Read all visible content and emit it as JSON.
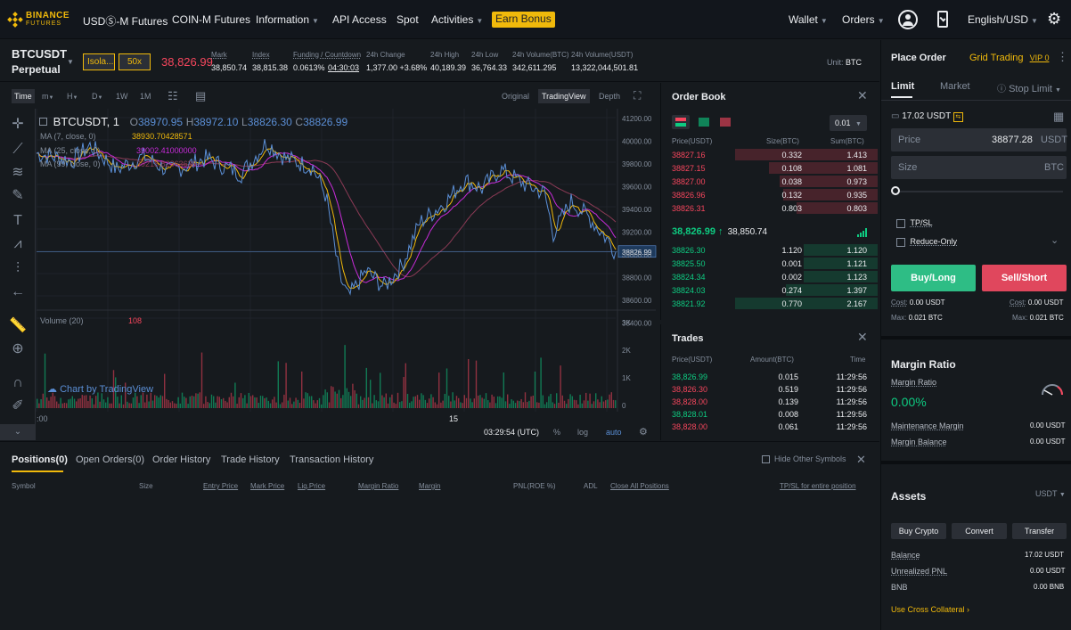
{
  "brand": {
    "line1": "BINANCE",
    "line2": "FUTURES"
  },
  "nav": {
    "usdm": "USDⓈ-M Futures",
    "coinm": "COIN-M Futures",
    "information": "Information",
    "api": "API Access",
    "spot": "Spot",
    "activities": "Activities",
    "earn": "Earn Bonus",
    "wallet": "Wallet",
    "orders": "Orders",
    "lang": "English/USD"
  },
  "ticker": {
    "symbol": "BTCUSDT",
    "type": "Perpetual",
    "margin_mode": "Isola...",
    "leverage": "50x",
    "last_price": "38,826.99",
    "mark_label": "Mark",
    "mark": "38,850.74",
    "index_label": "Index",
    "index": "38,815.38",
    "funding_label": "Funding / Countdown",
    "funding": "0.0613%",
    "countdown": "04:30:03",
    "change_label": "24h Change",
    "change": "1,377.00 +3.68%",
    "high_label": "24h High",
    "high": "40,189.39",
    "low_label": "24h Low",
    "low": "36,764.33",
    "volbtc_label": "24h Volume(BTC)",
    "volbtc": "342,611.295",
    "volusdt_label": "24h Volume(USDT)",
    "volusdt": "13,322,044,501.81",
    "unit_label": "Unit:",
    "unit": "BTC"
  },
  "chart_toolbar": {
    "time": "Time",
    "m": "m",
    "h": "H",
    "d": "D",
    "w": "1W",
    "mo": "1M",
    "original": "Original",
    "tradingview": "TradingView",
    "depth": "Depth"
  },
  "chart": {
    "title": "BTCUSDT, 1",
    "o": "38970.95",
    "h": "38972.10",
    "l": "38826.30",
    "c": "38826.99",
    "ma7_label": "MA (7, close, 0)",
    "ma7": "38930.70428571",
    "ma25_label": "MA (25, close, 0)",
    "ma25": "39002.41000000",
    "ma99_label": "MA (99, close, 0)",
    "ma99": "39218.82363636",
    "volume_label": "Volume (20)",
    "volume": "108",
    "watermark": "Chart by TradingView",
    "current_price_tag": "38826.99",
    "time_display": "03:29:54 (UTC)",
    "pct": "%",
    "log": "log",
    "auto": "auto",
    "x_tick_left": ":00",
    "x_tick_mid": "15",
    "colors": {
      "ma7": "#f0b90b",
      "ma25": "#c72bd8",
      "ma99": "#8b3a55",
      "price": "#5b8fd6"
    }
  },
  "chart_data": {
    "type": "line",
    "y_ticks": [
      "41200.00",
      "40000.00",
      "39800.00",
      "39600.00",
      "39400.00",
      "39200.00",
      "39000.00",
      "38800.00",
      "38600.00",
      "38400.00"
    ],
    "vol_ticks": [
      "3K",
      "2K",
      "1K",
      "0"
    ],
    "ylim": [
      38300,
      40100
    ]
  },
  "orderbook": {
    "title": "Order Book",
    "precision": "0.01",
    "headers": [
      "Price(USDT)",
      "Size(BTC)",
      "Sum(BTC)"
    ],
    "asks": [
      [
        "38827.16",
        "0.332",
        "1.413"
      ],
      [
        "38827.15",
        "0.108",
        "1.081"
      ],
      [
        "38827.00",
        "0.038",
        "0.973"
      ],
      [
        "38826.96",
        "0.132",
        "0.935"
      ],
      [
        "38826.31",
        "0.803",
        "0.803"
      ]
    ],
    "last": "38,826.99",
    "arrow": "↑",
    "mark": "38,850.74",
    "bids": [
      [
        "38826.30",
        "1.120",
        "1.120"
      ],
      [
        "38825.50",
        "0.001",
        "1.121"
      ],
      [
        "38824.34",
        "0.002",
        "1.123"
      ],
      [
        "38824.03",
        "0.274",
        "1.397"
      ],
      [
        "38821.92",
        "0.770",
        "2.167"
      ]
    ]
  },
  "trades": {
    "title": "Trades",
    "headers": [
      "Price(USDT)",
      "Amount(BTC)",
      "Time"
    ],
    "rows": [
      [
        "38,826.99",
        "0.015",
        "11:29:56",
        "green"
      ],
      [
        "38,826.30",
        "0.519",
        "11:29:56",
        "red"
      ],
      [
        "38,828.00",
        "0.139",
        "11:29:56",
        "red"
      ],
      [
        "38,828.01",
        "0.008",
        "11:29:56",
        "green"
      ],
      [
        "38,828.00",
        "0.061",
        "11:29:56",
        "red"
      ]
    ]
  },
  "bottom": {
    "tabs": [
      "Positions(0)",
      "Open Orders(0)",
      "Order History",
      "Trade History",
      "Transaction History"
    ],
    "hide_other": "Hide Other Symbols",
    "cols": [
      "Symbol",
      "Size",
      "Entry Price",
      "Mark Price",
      "Liq.Price",
      "Margin Ratio",
      "Margin",
      "PNL(ROE %)",
      "ADL",
      "Close All Positions",
      "TP/SL for entire position"
    ]
  },
  "order": {
    "title": "Place Order",
    "grid": "Grid Trading",
    "vip": "VIP 0",
    "tab_limit": "Limit",
    "tab_market": "Market",
    "tab_stop": "Stop Limit",
    "avail": "17.02 USDT",
    "price_label": "Price",
    "price_value": "38877.28",
    "price_unit": "USDT",
    "size_label": "Size",
    "size_unit": "BTC",
    "tpsl": "TP/SL",
    "reduce": "Reduce-Only",
    "buy": "Buy/Long",
    "sell": "Sell/Short",
    "cost_label": "Cost:",
    "cost_buy": "0.00 USDT",
    "cost_sell": "0.00 USDT",
    "max_label": "Max:",
    "max_buy": "0.021 BTC",
    "max_sell": "0.021 BTC"
  },
  "margin": {
    "title": "Margin Ratio",
    "ratio_label": "Margin Ratio",
    "ratio": "0.00%",
    "maint_label": "Maintenance Margin",
    "maint": "0.00 USDT",
    "balance_label": "Margin Balance",
    "balance": "0.00 USDT"
  },
  "assets": {
    "title": "Assets",
    "currency": "USDT",
    "buy": "Buy Crypto",
    "convert": "Convert",
    "transfer": "Transfer",
    "balance_label": "Balance",
    "balance": "17.02 USDT",
    "upnl_label": "Unrealized PNL",
    "upnl": "0.00 USDT",
    "bnb_label": "BNB",
    "bnb": "0.00 BNB",
    "cross": "Use Cross Collateral"
  }
}
